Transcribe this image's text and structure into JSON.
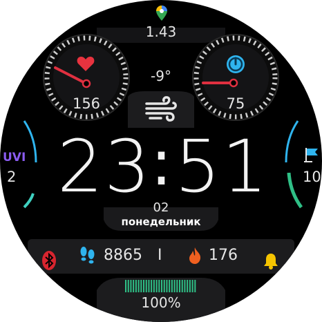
{
  "colors": {
    "background": "#000000",
    "panel": "#1c1c1e",
    "text": "#e6e6e6",
    "heart_red": "#e8333f",
    "needle_red": "#e03040",
    "cyan_accent": "#2fb4ee",
    "battery_green": "#2fbf86",
    "flame_orange": "#f06020",
    "bell_yellow": "#f5c400",
    "uvi_purple": "#8a5cf0",
    "teal_arc": "#3fd0c0"
  },
  "distance": {
    "icon": "map-pin-icon",
    "value": "1.43"
  },
  "heart_gauge": {
    "icon": "heart-icon",
    "value": "156",
    "level_fraction": 0.25
  },
  "weather": {
    "temperature": "-9°",
    "icon": "wind-icon"
  },
  "stress_gauge": {
    "icon": "stress-icon",
    "value": "75",
    "level_fraction": 0.3
  },
  "uvi": {
    "label": "UVI",
    "value": "2"
  },
  "right_complication": {
    "icon": "flag-icon",
    "value": "10"
  },
  "time": {
    "hours": "23",
    "separator": ":",
    "minutes": "51"
  },
  "date": {
    "day": "02",
    "weekday": "понедельник"
  },
  "bottom_bar": {
    "bluetooth_icon": "bluetooth-icon",
    "steps_icon": "footsteps-icon",
    "steps": "8865",
    "separator": "I",
    "calories_icon": "flame-icon",
    "calories": "176",
    "alarm_icon": "bell-icon"
  },
  "battery": {
    "value": "100%",
    "level_fraction": 1.0
  }
}
